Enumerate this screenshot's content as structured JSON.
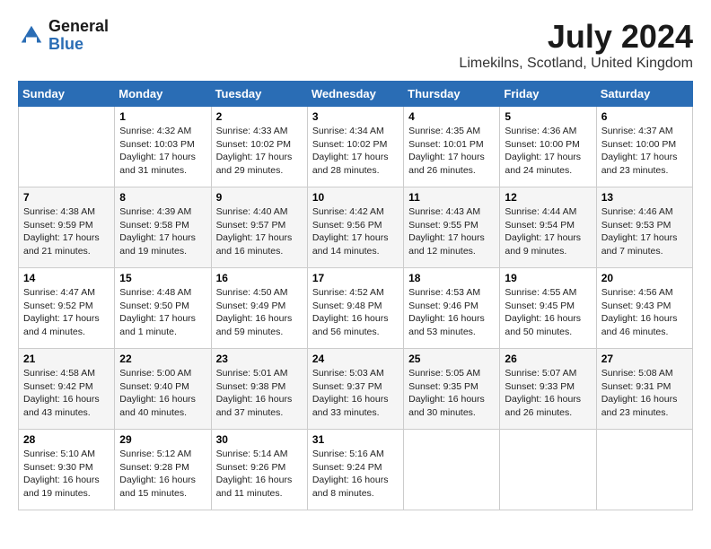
{
  "logo": {
    "general": "General",
    "blue": "Blue"
  },
  "title": "July 2024",
  "location": "Limekilns, Scotland, United Kingdom",
  "days_of_week": [
    "Sunday",
    "Monday",
    "Tuesday",
    "Wednesday",
    "Thursday",
    "Friday",
    "Saturday"
  ],
  "weeks": [
    [
      {
        "day": "",
        "info": ""
      },
      {
        "day": "1",
        "info": "Sunrise: 4:32 AM\nSunset: 10:03 PM\nDaylight: 17 hours\nand 31 minutes."
      },
      {
        "day": "2",
        "info": "Sunrise: 4:33 AM\nSunset: 10:02 PM\nDaylight: 17 hours\nand 29 minutes."
      },
      {
        "day": "3",
        "info": "Sunrise: 4:34 AM\nSunset: 10:02 PM\nDaylight: 17 hours\nand 28 minutes."
      },
      {
        "day": "4",
        "info": "Sunrise: 4:35 AM\nSunset: 10:01 PM\nDaylight: 17 hours\nand 26 minutes."
      },
      {
        "day": "5",
        "info": "Sunrise: 4:36 AM\nSunset: 10:00 PM\nDaylight: 17 hours\nand 24 minutes."
      },
      {
        "day": "6",
        "info": "Sunrise: 4:37 AM\nSunset: 10:00 PM\nDaylight: 17 hours\nand 23 minutes."
      }
    ],
    [
      {
        "day": "7",
        "info": "Sunrise: 4:38 AM\nSunset: 9:59 PM\nDaylight: 17 hours\nand 21 minutes."
      },
      {
        "day": "8",
        "info": "Sunrise: 4:39 AM\nSunset: 9:58 PM\nDaylight: 17 hours\nand 19 minutes."
      },
      {
        "day": "9",
        "info": "Sunrise: 4:40 AM\nSunset: 9:57 PM\nDaylight: 17 hours\nand 16 minutes."
      },
      {
        "day": "10",
        "info": "Sunrise: 4:42 AM\nSunset: 9:56 PM\nDaylight: 17 hours\nand 14 minutes."
      },
      {
        "day": "11",
        "info": "Sunrise: 4:43 AM\nSunset: 9:55 PM\nDaylight: 17 hours\nand 12 minutes."
      },
      {
        "day": "12",
        "info": "Sunrise: 4:44 AM\nSunset: 9:54 PM\nDaylight: 17 hours\nand 9 minutes."
      },
      {
        "day": "13",
        "info": "Sunrise: 4:46 AM\nSunset: 9:53 PM\nDaylight: 17 hours\nand 7 minutes."
      }
    ],
    [
      {
        "day": "14",
        "info": "Sunrise: 4:47 AM\nSunset: 9:52 PM\nDaylight: 17 hours\nand 4 minutes."
      },
      {
        "day": "15",
        "info": "Sunrise: 4:48 AM\nSunset: 9:50 PM\nDaylight: 17 hours\nand 1 minute."
      },
      {
        "day": "16",
        "info": "Sunrise: 4:50 AM\nSunset: 9:49 PM\nDaylight: 16 hours\nand 59 minutes."
      },
      {
        "day": "17",
        "info": "Sunrise: 4:52 AM\nSunset: 9:48 PM\nDaylight: 16 hours\nand 56 minutes."
      },
      {
        "day": "18",
        "info": "Sunrise: 4:53 AM\nSunset: 9:46 PM\nDaylight: 16 hours\nand 53 minutes."
      },
      {
        "day": "19",
        "info": "Sunrise: 4:55 AM\nSunset: 9:45 PM\nDaylight: 16 hours\nand 50 minutes."
      },
      {
        "day": "20",
        "info": "Sunrise: 4:56 AM\nSunset: 9:43 PM\nDaylight: 16 hours\nand 46 minutes."
      }
    ],
    [
      {
        "day": "21",
        "info": "Sunrise: 4:58 AM\nSunset: 9:42 PM\nDaylight: 16 hours\nand 43 minutes."
      },
      {
        "day": "22",
        "info": "Sunrise: 5:00 AM\nSunset: 9:40 PM\nDaylight: 16 hours\nand 40 minutes."
      },
      {
        "day": "23",
        "info": "Sunrise: 5:01 AM\nSunset: 9:38 PM\nDaylight: 16 hours\nand 37 minutes."
      },
      {
        "day": "24",
        "info": "Sunrise: 5:03 AM\nSunset: 9:37 PM\nDaylight: 16 hours\nand 33 minutes."
      },
      {
        "day": "25",
        "info": "Sunrise: 5:05 AM\nSunset: 9:35 PM\nDaylight: 16 hours\nand 30 minutes."
      },
      {
        "day": "26",
        "info": "Sunrise: 5:07 AM\nSunset: 9:33 PM\nDaylight: 16 hours\nand 26 minutes."
      },
      {
        "day": "27",
        "info": "Sunrise: 5:08 AM\nSunset: 9:31 PM\nDaylight: 16 hours\nand 23 minutes."
      }
    ],
    [
      {
        "day": "28",
        "info": "Sunrise: 5:10 AM\nSunset: 9:30 PM\nDaylight: 16 hours\nand 19 minutes."
      },
      {
        "day": "29",
        "info": "Sunrise: 5:12 AM\nSunset: 9:28 PM\nDaylight: 16 hours\nand 15 minutes."
      },
      {
        "day": "30",
        "info": "Sunrise: 5:14 AM\nSunset: 9:26 PM\nDaylight: 16 hours\nand 11 minutes."
      },
      {
        "day": "31",
        "info": "Sunrise: 5:16 AM\nSunset: 9:24 PM\nDaylight: 16 hours\nand 8 minutes."
      },
      {
        "day": "",
        "info": ""
      },
      {
        "day": "",
        "info": ""
      },
      {
        "day": "",
        "info": ""
      }
    ]
  ]
}
